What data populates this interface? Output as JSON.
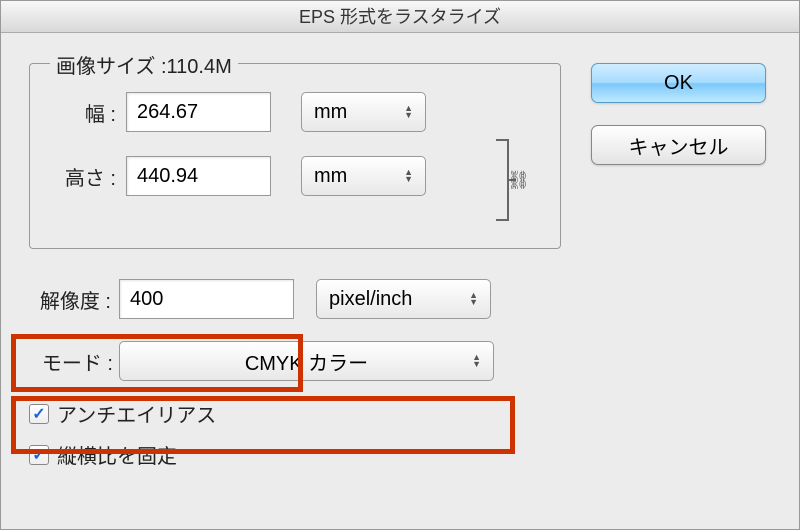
{
  "title": "EPS 形式をラスタライズ",
  "imageSize": {
    "legend": "画像サイズ :110.4M",
    "widthLabel": "幅 :",
    "widthValue": "264.67",
    "widthUnit": "mm",
    "heightLabel": "高さ :",
    "heightValue": "440.94",
    "heightUnit": "mm",
    "linkIcon": "⛓"
  },
  "resolution": {
    "label": "解像度 :",
    "value": "400",
    "unit": "pixel/inch"
  },
  "mode": {
    "label": "モード :",
    "value": "CMYK カラー"
  },
  "checkboxes": {
    "antialias": "アンチエイリアス",
    "constrain": "縦横比を固定",
    "checkMark": "✓"
  },
  "buttons": {
    "ok": "OK",
    "cancel": "キャンセル"
  }
}
